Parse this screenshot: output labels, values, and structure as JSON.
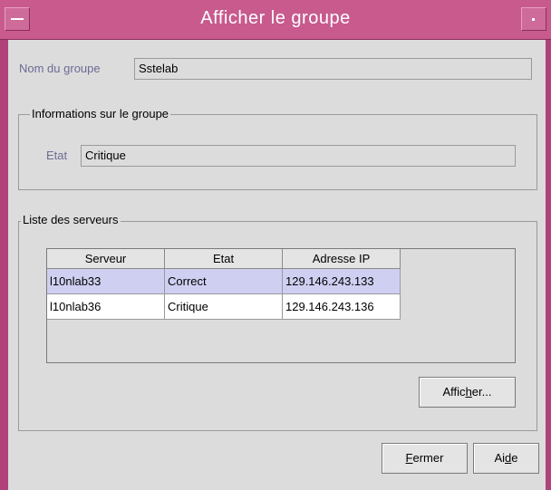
{
  "window": {
    "title": "Afficher le groupe"
  },
  "group_name": {
    "label": "Nom du groupe",
    "value": "Sstelab"
  },
  "info_group": {
    "title": "Informations sur le groupe",
    "state_label": "Etat",
    "state_value": "Critique"
  },
  "servers": {
    "title": "Liste des serveurs",
    "columns": [
      "Serveur",
      "Etat",
      "Adresse IP"
    ],
    "rows": [
      {
        "server": "l10nlab33",
        "state": "Correct",
        "ip": "129.146.243.133",
        "selected": true
      },
      {
        "server": "l10nlab36",
        "state": "Critique",
        "ip": "129.146.243.136",
        "selected": false
      }
    ],
    "show_button": {
      "pre": "Affic",
      "mnemonic": "h",
      "post": "er..."
    }
  },
  "footer": {
    "close_button": {
      "mnemonic": "F",
      "post": "ermer"
    },
    "help_button": {
      "pre": "Ai",
      "mnemonic": "d",
      "post": "e"
    }
  }
}
